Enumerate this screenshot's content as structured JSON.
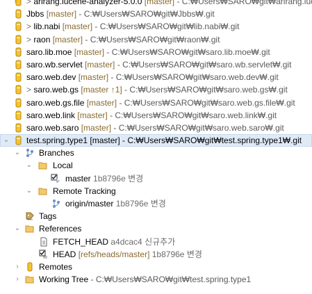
{
  "repositories": [
    {
      "name": "arirang.lucene-analyzer-5.0.0",
      "prefix": "> ",
      "branch": "[master]",
      "path": "- C:₩Users₩SARO₩git₩arirang.luce"
    },
    {
      "name": "Jbbs",
      "prefix": "",
      "branch": "[master]",
      "path": "- C:₩Users₩SARO₩git₩Jbbs₩.git"
    },
    {
      "name": "lib.nabi",
      "prefix": "> ",
      "branch": "[master]",
      "path": "- C:₩Users₩SARO₩git₩lib.nabi₩.git"
    },
    {
      "name": "raon",
      "prefix": "> ",
      "branch": "[master]",
      "path": "- C:₩Users₩SARO₩git₩raon₩.git"
    },
    {
      "name": "saro.lib.moe",
      "prefix": "",
      "branch": "[master]",
      "path": "- C:₩Users₩SARO₩git₩saro.lib.moe₩.git"
    },
    {
      "name": "saro.wb.servlet",
      "prefix": "",
      "branch": "[master]",
      "path": "- C:₩Users₩SARO₩git₩saro.wb.servlet₩.git"
    },
    {
      "name": "saro.web.dev",
      "prefix": "",
      "branch": "[master]",
      "path": "- C:₩Users₩SARO₩git₩saro.web.dev₩.git"
    },
    {
      "name": "saro.web.gs",
      "prefix": "> ",
      "branch": "[master ↑1]",
      "path": "- C:₩Users₩SARO₩git₩saro.web.gs₩.git"
    },
    {
      "name": "saro.web.gs.file",
      "prefix": "",
      "branch": "[master]",
      "path": "- C:₩Users₩SARO₩git₩saro.web.gs.file₩.git"
    },
    {
      "name": "saro.web.link",
      "prefix": "",
      "branch": "[master]",
      "path": "- C:₩Users₩SARO₩git₩saro.web.link₩.git"
    },
    {
      "name": "saro.web.saro",
      "prefix": "",
      "branch": "[master]",
      "path": "- C:₩Users₩SARO₩git₩saro.web.saro₩.git"
    }
  ],
  "selected_repo": {
    "text": "test.spring.type1 [master] - C:₩Users₩SARO₩git₩test.spring.type1₩.git"
  },
  "branches": {
    "label": "Branches",
    "local": {
      "label": "Local",
      "items": [
        {
          "name": "master",
          "hash": "1b8796e",
          "msg": "변경"
        }
      ]
    },
    "remote": {
      "label": "Remote Tracking",
      "items": [
        {
          "name": "origin/master",
          "hash": "1b8796e",
          "msg": "변경"
        }
      ]
    }
  },
  "tags": {
    "label": "Tags"
  },
  "references": {
    "label": "References",
    "fetch_head": {
      "name": "FETCH_HEAD",
      "hash": "a4dcac4",
      "msg": "신규추가"
    },
    "head": {
      "name": "HEAD",
      "ref": "[refs/heads/master]",
      "hash": "1b8796e",
      "msg": "변경"
    }
  },
  "remotes": {
    "label": "Remotes"
  },
  "working_tree": {
    "label": "Working Tree",
    "path": "- C:₩Users₩SARO₩git₩test.spring.type1"
  },
  "icons": {
    "repo": "git-repository-icon",
    "folder": "folder-icon",
    "branch": "branch-icon",
    "tag": "tag-icon",
    "ref": "reference-icon",
    "remote": "remote-icon"
  },
  "colors": {
    "selection": "#dfeaf7",
    "branch_text": "#8a6a2e",
    "path_text": "#5a5a5a"
  }
}
